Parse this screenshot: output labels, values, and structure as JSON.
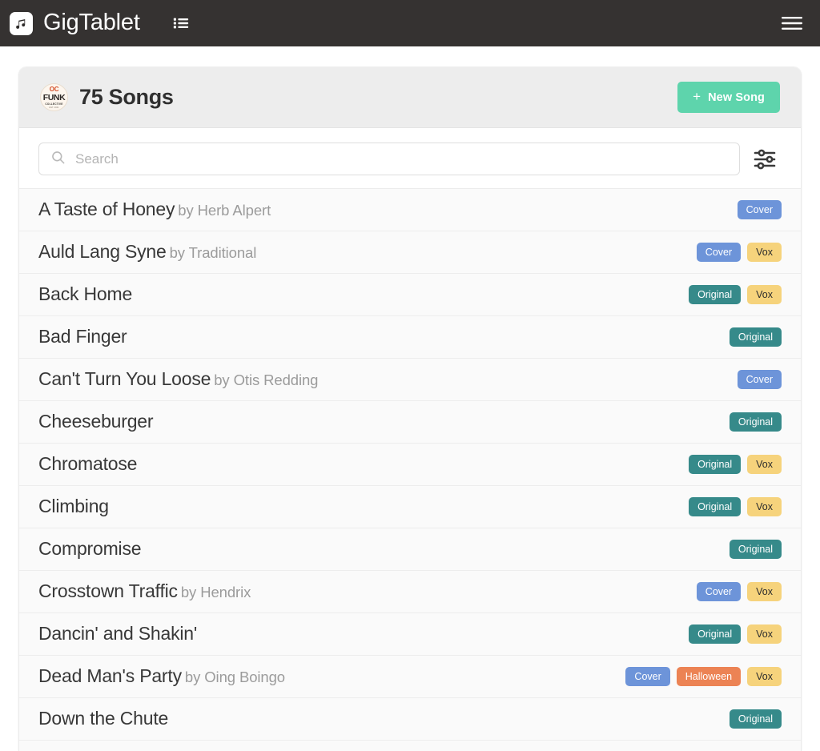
{
  "appbar": {
    "brand_title": "GigTablet",
    "logo_icon": "music-note-icon",
    "list_icon": "list-icon",
    "menu_icon": "hamburger-menu-icon"
  },
  "card": {
    "band_badge": {
      "line1": "OC",
      "line2": "FUNK",
      "line3": "COLLECTIVE",
      "line4": "EST. 2021"
    },
    "title": "75 Songs",
    "new_song_button": {
      "label": "New Song",
      "plus": "+",
      "color": "#5ed4ac"
    }
  },
  "search": {
    "placeholder": "Search",
    "value": "",
    "icon": "search-icon",
    "filter_icon": "sliders-filter-icon"
  },
  "tag_colors": {
    "Cover": "#6d94d9",
    "Original": "#368a8a",
    "Vox": "#f6d37c",
    "Halloween": "#ec8354"
  },
  "songs": [
    {
      "title": "A Taste of Honey",
      "by": "by",
      "artist": "Herb Alpert",
      "tags": [
        "Cover"
      ]
    },
    {
      "title": "Auld Lang Syne",
      "by": "by",
      "artist": "Traditional",
      "tags": [
        "Cover",
        "Vox"
      ]
    },
    {
      "title": "Back Home",
      "by": "",
      "artist": "",
      "tags": [
        "Original",
        "Vox"
      ]
    },
    {
      "title": "Bad Finger",
      "by": "",
      "artist": "",
      "tags": [
        "Original"
      ]
    },
    {
      "title": "Can't Turn You Loose",
      "by": "by",
      "artist": "Otis Redding",
      "tags": [
        "Cover"
      ]
    },
    {
      "title": "Cheeseburger",
      "by": "",
      "artist": "",
      "tags": [
        "Original"
      ]
    },
    {
      "title": "Chromatose",
      "by": "",
      "artist": "",
      "tags": [
        "Original",
        "Vox"
      ]
    },
    {
      "title": "Climbing",
      "by": "",
      "artist": "",
      "tags": [
        "Original",
        "Vox"
      ]
    },
    {
      "title": "Compromise",
      "by": "",
      "artist": "",
      "tags": [
        "Original"
      ]
    },
    {
      "title": "Crosstown Traffic",
      "by": "by",
      "artist": "Hendrix",
      "tags": [
        "Cover",
        "Vox"
      ]
    },
    {
      "title": "Dancin' and Shakin'",
      "by": "",
      "artist": "",
      "tags": [
        "Original",
        "Vox"
      ]
    },
    {
      "title": "Dead Man's Party",
      "by": "by",
      "artist": "Oing Boingo",
      "tags": [
        "Cover",
        "Halloween",
        "Vox"
      ]
    },
    {
      "title": "Down the Chute",
      "by": "",
      "artist": "",
      "tags": [
        "Original"
      ]
    }
  ]
}
